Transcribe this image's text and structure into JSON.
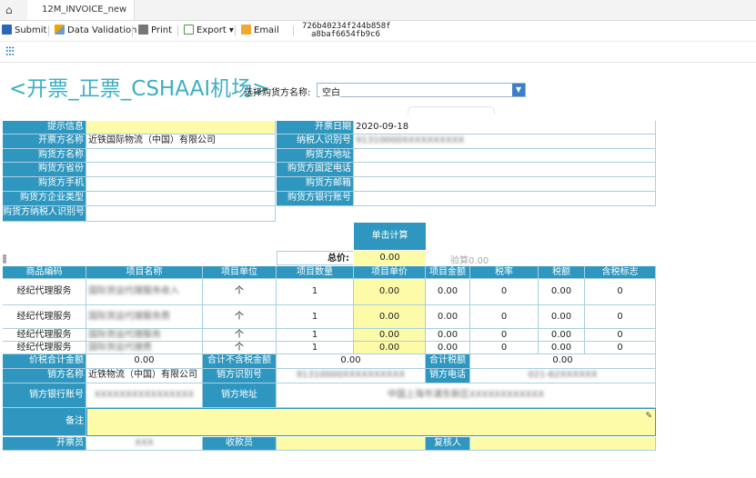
{
  "tab": {
    "title": "12M_INVOICE_new"
  },
  "toolbar": {
    "submit": "Submit",
    "data_validation": "Data Validation",
    "print": "Print",
    "export": "Export",
    "email": "Email",
    "invoice_id_line1": "726b40234f244b858f",
    "invoice_id_line2": "a8baf6654fb9c6"
  },
  "form": {
    "title": "<开票_正票_CSHAAI机场>",
    "buyer_select_label": "选择购货方名称:",
    "buyer_select_value": "空白"
  },
  "header_labels": {
    "tip": "提示信息",
    "issuer_name": "开票方名称",
    "buyer_name": "购货方名称",
    "buyer_province": "购货方省份",
    "buyer_mobile": "购货方手机",
    "buyer_company_type": "购货方企业类型",
    "buyer_taxpayer_id": "购货方纳税人识别号",
    "issue_date": "开票日期",
    "taxpayer_id": "纳税人识别号",
    "buyer_address": "购货方地址",
    "buyer_phone": "购货方固定电话",
    "buyer_email": "购货方邮箱",
    "buyer_bank": "购货方银行账号"
  },
  "header_values": {
    "tip": "",
    "issuer_name": "近铁国际物流（中国）有限公司",
    "issue_date": "2020-09-18",
    "taxpayer_id": "91310000XXXXXXXXXX"
  },
  "calc": {
    "button": "单击计算",
    "total_label": "总价:",
    "total_value": "0.00",
    "check_label": "验算",
    "check_value": "0.00"
  },
  "items": {
    "columns": [
      "商品编码",
      "项目名称",
      "项目单位",
      "项目数量",
      "项目单价",
      "项目金额",
      "税率",
      "税额",
      "含税标志"
    ],
    "rows": [
      {
        "code": "经纪代理服务",
        "name": "国际货运代理服务收入",
        "unit": "个",
        "qty": "1",
        "price": "0.00",
        "amount": "0.00",
        "rate": "0",
        "tax": "0.00",
        "flag": "0"
      },
      {
        "code": "经纪代理服务",
        "name": "国际货运代理服务费",
        "unit": "个",
        "qty": "1",
        "price": "0.00",
        "amount": "0.00",
        "rate": "0",
        "tax": "0.00",
        "flag": "0"
      },
      {
        "code": "经纪代理服务",
        "name": "国际货运代理服务",
        "unit": "个",
        "qty": "1",
        "price": "0.00",
        "amount": "0.00",
        "rate": "0",
        "tax": "0.00",
        "flag": "0"
      },
      {
        "code": "经纪代理服务",
        "name": "国际货运代理费",
        "unit": "个",
        "qty": "1",
        "price": "0.00",
        "amount": "0.00",
        "rate": "0",
        "tax": "0.00",
        "flag": "0"
      }
    ]
  },
  "totals": {
    "total_with_tax_label": "价税合计金额",
    "total_with_tax": "0.00",
    "total_without_tax_label": "合计不含税金额",
    "total_without_tax": "0.00",
    "total_tax_label": "合计税额",
    "total_tax": "0.00"
  },
  "seller": {
    "name_label": "销方名称",
    "name": "近铁物流（中国）有限公司",
    "id_label": "销方识别号",
    "id": "91310000XXXXXXXXXX",
    "phone_label": "销方电话",
    "phone": "021-62XXXXXX",
    "bank_label": "销方银行账号",
    "bank": "XXXXXXXXXXXXXXXX",
    "address_label": "销方地址",
    "address": "中国上海市浦东新区XXXXXXXXXXXX"
  },
  "remark": {
    "label": "备注",
    "value": ""
  },
  "people": {
    "issuer_label": "开票员",
    "issuer": "XXX",
    "payee_label": "收款员",
    "payee": "",
    "reviewer_label": "复核人",
    "reviewer": ""
  },
  "colors": {
    "header_blue": "#2f97bf",
    "highlight_yellow": "#fdfba8",
    "title_teal": "#3bb0c4"
  }
}
